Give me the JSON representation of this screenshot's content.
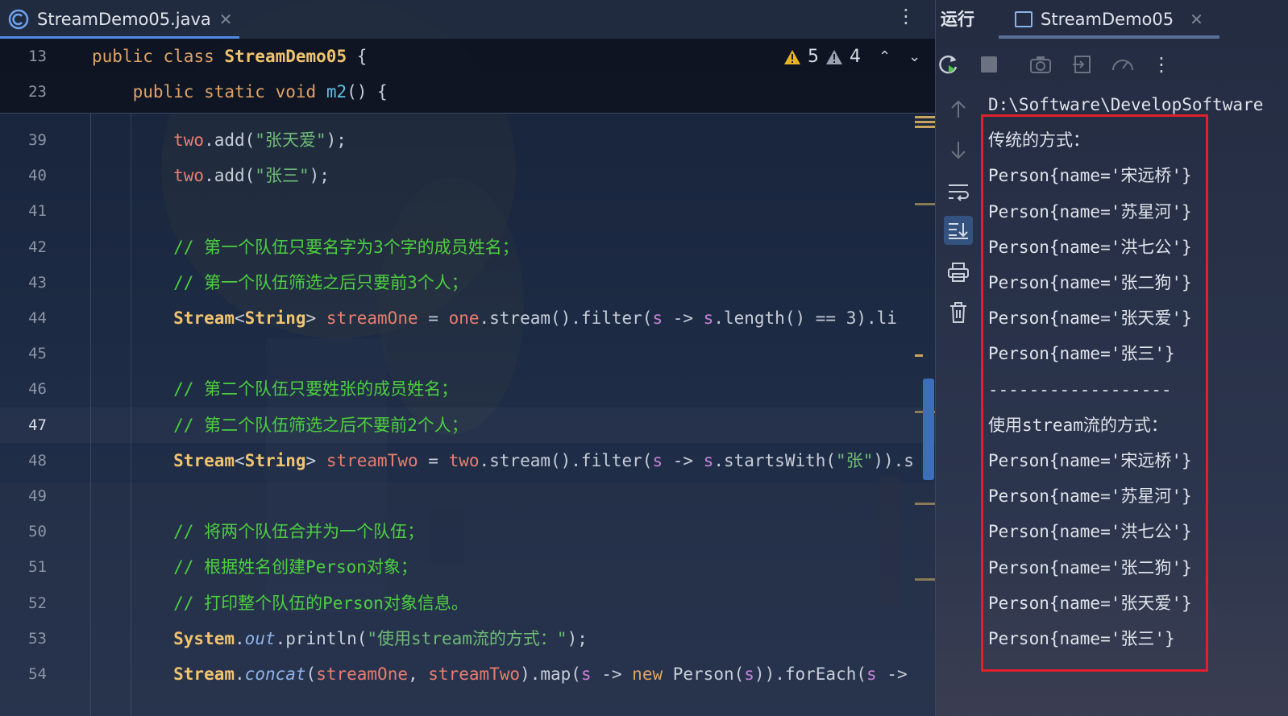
{
  "editor": {
    "tab_label": "StreamDemo05.java",
    "tab_close": "✕",
    "more": "⋮",
    "sticky": [
      {
        "num": "13",
        "tokens": [
          [
            "kw",
            "public "
          ],
          [
            "kw",
            "class "
          ],
          [
            "cls",
            "StreamDemo05"
          ],
          [
            "ident",
            " {"
          ]
        ]
      },
      {
        "num": "23",
        "tokens": [
          [
            "kw",
            "    public "
          ],
          [
            "kw",
            "static "
          ],
          [
            "kw",
            "void "
          ],
          [
            "fn",
            "m2"
          ],
          [
            "ident",
            "() {"
          ]
        ]
      }
    ],
    "inspections": {
      "warnings": "5",
      "weak_warnings": "4",
      "up": "⌃",
      "down": "⌄"
    },
    "lines": [
      {
        "num": "39",
        "tokens": [
          [
            "var",
            "        two"
          ],
          [
            "ident",
            ".add("
          ],
          [
            "str",
            "\"张天爱\""
          ],
          [
            "ident",
            ");"
          ]
        ]
      },
      {
        "num": "40",
        "tokens": [
          [
            "var",
            "        two"
          ],
          [
            "ident",
            ".add("
          ],
          [
            "str",
            "\"张三\""
          ],
          [
            "ident",
            ");"
          ]
        ]
      },
      {
        "num": "41",
        "tokens": []
      },
      {
        "num": "42",
        "tokens": [
          [
            "cmt",
            "        // 第一个队伍只要名字为3个字的成员姓名；"
          ]
        ]
      },
      {
        "num": "43",
        "tokens": [
          [
            "cmt",
            "        // 第一个队伍筛选之后只要前3个人；"
          ]
        ]
      },
      {
        "num": "44",
        "tokens": [
          [
            "cls",
            "        Stream"
          ],
          [
            "ident",
            "<"
          ],
          [
            "cls",
            "String"
          ],
          [
            "ident",
            "> "
          ],
          [
            "var",
            "streamOne"
          ],
          [
            "ident",
            " = "
          ],
          [
            "var",
            "one"
          ],
          [
            "ident",
            ".stream().filter("
          ],
          [
            "par",
            "s"
          ],
          [
            "ident",
            " -> "
          ],
          [
            "par",
            "s"
          ],
          [
            "ident",
            ".length() == 3).li"
          ]
        ]
      },
      {
        "num": "45",
        "tokens": []
      },
      {
        "num": "46",
        "tokens": [
          [
            "cmt",
            "        // 第二个队伍只要姓张的成员姓名；"
          ]
        ]
      },
      {
        "num": "47",
        "tokens": [
          [
            "cmt",
            "        // 第二个队伍筛选之后不要前2个人；"
          ]
        ],
        "current": true
      },
      {
        "num": "48",
        "tokens": [
          [
            "cls",
            "        Stream"
          ],
          [
            "ident",
            "<"
          ],
          [
            "cls",
            "String"
          ],
          [
            "ident",
            "> "
          ],
          [
            "var",
            "streamTwo"
          ],
          [
            "ident",
            " = "
          ],
          [
            "var",
            "two"
          ],
          [
            "ident",
            ".stream().filter("
          ],
          [
            "par",
            "s"
          ],
          [
            "ident",
            " -> "
          ],
          [
            "par",
            "s"
          ],
          [
            "ident",
            ".startsWith("
          ],
          [
            "str",
            "\"张\""
          ],
          [
            "ident",
            ")).s"
          ]
        ]
      },
      {
        "num": "49",
        "tokens": []
      },
      {
        "num": "50",
        "tokens": [
          [
            "cmt",
            "        // 将两个队伍合并为一个队伍；"
          ]
        ]
      },
      {
        "num": "51",
        "tokens": [
          [
            "cmt",
            "        // 根据姓名创建Person对象；"
          ]
        ]
      },
      {
        "num": "52",
        "tokens": [
          [
            "cmt",
            "        // 打印整个队伍的Person对象信息。"
          ]
        ]
      },
      {
        "num": "53",
        "tokens": [
          [
            "cls",
            "        System"
          ],
          [
            "ident",
            "."
          ],
          [
            "ital",
            "out"
          ],
          [
            "ident",
            ".println("
          ],
          [
            "str",
            "\"使用stream流的方式：\""
          ],
          [
            "ident",
            ");"
          ]
        ]
      },
      {
        "num": "54",
        "tokens": [
          [
            "cls",
            "        Stream"
          ],
          [
            "ident",
            "."
          ],
          [
            "ital",
            "concat"
          ],
          [
            "ident",
            "("
          ],
          [
            "var",
            "streamOne"
          ],
          [
            "ident",
            ", "
          ],
          [
            "var",
            "streamTwo"
          ],
          [
            "ident",
            ").map("
          ],
          [
            "par",
            "s"
          ],
          [
            "ident",
            " -> "
          ],
          [
            "kw",
            "new "
          ],
          [
            "ident",
            "Person("
          ],
          [
            "par",
            "s"
          ],
          [
            "ident",
            ")).forEach("
          ],
          [
            "par",
            "s"
          ],
          [
            "ident",
            " ->"
          ]
        ]
      }
    ]
  },
  "run": {
    "title": "运行",
    "tab_label": "StreamDemo05",
    "tab_close": "✕",
    "console": [
      "D:\\Software\\DevelopSoftware",
      "传统的方式：",
      "Person{name='宋远桥'}",
      "Person{name='苏星河'}",
      "Person{name='洪七公'}",
      "Person{name='张二狗'}",
      "Person{name='张天爱'}",
      "Person{name='张三'}",
      "------------------",
      "使用stream流的方式：",
      "Person{name='宋远桥'}",
      "Person{name='苏星河'}",
      "Person{name='洪七公'}",
      "Person{name='张二狗'}",
      "Person{name='张天爱'}",
      "Person{name='张三'}"
    ]
  },
  "colors": {
    "accent": "#4f8ae6",
    "highlight_box": "#e0202a",
    "comment": "#4ccf3f"
  }
}
